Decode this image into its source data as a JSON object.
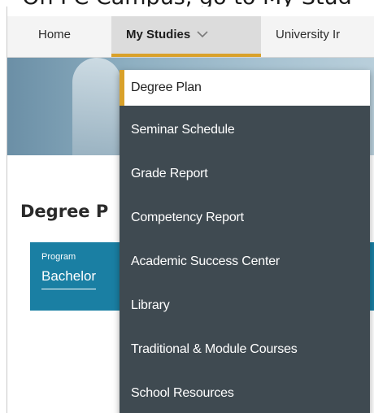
{
  "caption": "On PC Campus, go to My Stud",
  "nav": {
    "home": "Home",
    "my_studies": "My Studies",
    "university": "University Ir"
  },
  "page": {
    "section_title": "Degree P",
    "program_label": "Program",
    "program_value": "Bachelor"
  },
  "dropdown": {
    "items": [
      {
        "label": "Degree Plan",
        "active": true
      },
      {
        "label": "Seminar Schedule"
      },
      {
        "label": "Grade Report"
      },
      {
        "label": "Competency Report"
      },
      {
        "label": "Academic Success Center"
      },
      {
        "label": "Library"
      },
      {
        "label": "Traditional & Module Courses"
      },
      {
        "label": "School Resources"
      }
    ]
  },
  "colors": {
    "accent": "#d9a12a",
    "menu_bg": "#3f4a51",
    "program_bar": "#1a7fa3"
  },
  "icons": {
    "my_studies_chevron": "chevron-down-icon"
  }
}
